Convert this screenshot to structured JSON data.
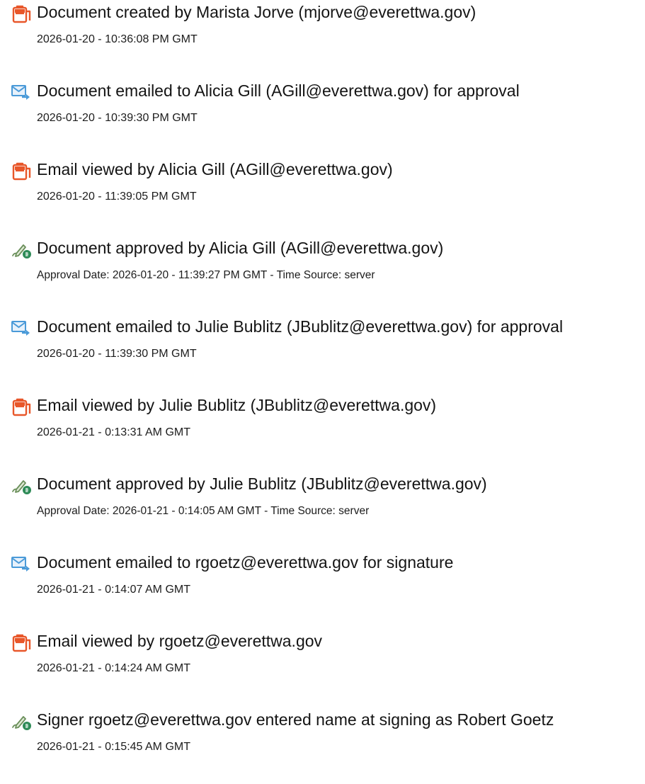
{
  "colors": {
    "doc_icon": "#e8572a",
    "mail_icon": "#4a9ad8",
    "sign_icon_pen": "#6a8f5a",
    "sign_icon_badge": "#2e8b57"
  },
  "events": [
    {
      "icon": "document-icon",
      "title": "Document created by Marista Jorve (mjorve@everettwa.gov)",
      "meta": "2026-01-20 - 10:36:08 PM GMT"
    },
    {
      "icon": "email-sent-icon",
      "title": "Document emailed to Alicia Gill (AGill@everettwa.gov) for approval",
      "meta": "2026-01-20 - 10:39:30 PM GMT"
    },
    {
      "icon": "document-icon",
      "title": "Email viewed by Alicia Gill (AGill@everettwa.gov)",
      "meta": "2026-01-20 - 11:39:05 PM GMT"
    },
    {
      "icon": "signature-pen-icon",
      "title": "Document approved by Alicia Gill (AGill@everettwa.gov)",
      "meta": "Approval Date: 2026-01-20 - 11:39:27 PM GMT - Time Source: server"
    },
    {
      "icon": "email-sent-icon",
      "title": "Document emailed to Julie Bublitz (JBublitz@everettwa.gov) for approval",
      "meta": "2026-01-20 - 11:39:30 PM GMT"
    },
    {
      "icon": "document-icon",
      "title": "Email viewed by Julie Bublitz (JBublitz@everettwa.gov)",
      "meta": "2026-01-21 - 0:13:31 AM GMT"
    },
    {
      "icon": "signature-pen-icon",
      "title": "Document approved by Julie Bublitz (JBublitz@everettwa.gov)",
      "meta": "Approval Date: 2026-01-21 - 0:14:05 AM GMT - Time Source: server"
    },
    {
      "icon": "email-sent-icon",
      "title": "Document emailed to rgoetz@everettwa.gov for signature",
      "meta": "2026-01-21 - 0:14:07 AM GMT"
    },
    {
      "icon": "document-icon",
      "title": "Email viewed by rgoetz@everettwa.gov",
      "meta": "2026-01-21 - 0:14:24 AM GMT"
    },
    {
      "icon": "signature-pen-icon",
      "title": "Signer rgoetz@everettwa.gov entered name at signing as Robert Goetz",
      "meta": "2026-01-21 - 0:15:45 AM GMT"
    }
  ]
}
